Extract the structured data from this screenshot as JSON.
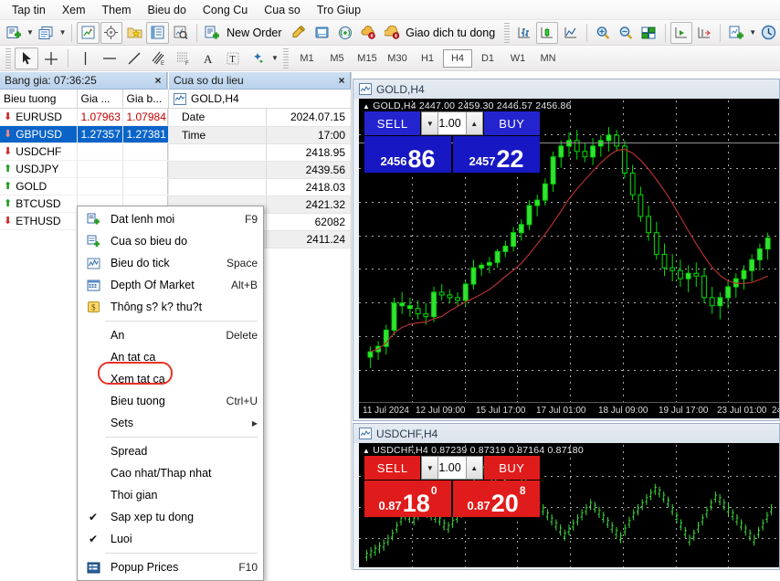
{
  "menubar": {
    "items": [
      {
        "label": "Tap tin"
      },
      {
        "label": "Xem"
      },
      {
        "label": "Them"
      },
      {
        "label": "Bieu do"
      },
      {
        "label": "Cong Cu"
      },
      {
        "label": "Cua so"
      },
      {
        "label": "Tro Giup"
      }
    ]
  },
  "toolbar_main": {
    "new_order_label": "New Order",
    "autotrading_label": "Giao dich tu dong",
    "icons": [
      "new-chart-icon",
      "chart-window-icon",
      "market-watch-icon",
      "navigator-icon",
      "favorites-icon",
      "data-window-icon",
      "terminal-icon",
      "new-order-icon",
      "metaeditor-icon",
      "mql5-community-icon",
      "signals-icon",
      "vps-icon",
      "bar-chart-icon",
      "candlestick-chart-icon",
      "line-chart-icon",
      "zoom-in-icon",
      "zoom-out-icon",
      "tile-windows-icon",
      "autoscroll-icon",
      "chart-shift-icon",
      "templates-icon",
      "period-icon"
    ]
  },
  "toolbar_tools": {
    "icons": [
      "cursor-icon",
      "crosshair-icon",
      "vertical-line-icon",
      "horizontal-line-icon",
      "trendline-icon",
      "equidistant-channel-icon",
      "fibonacci-icon",
      "text-icon",
      "text-label-icon",
      "objects-icon"
    ]
  },
  "timeframes": {
    "items": [
      "M1",
      "M5",
      "M15",
      "M30",
      "H1",
      "H4",
      "D1",
      "W1",
      "MN"
    ],
    "active": "H4"
  },
  "market_watch": {
    "title": "Bang gia: 07:36:25",
    "close_label": "×",
    "columns": [
      "Bieu tuong",
      "Gia ...",
      "Gia b..."
    ],
    "rows": [
      {
        "symbol": "EURUSD",
        "dir": "down",
        "bid": "1.07963",
        "ask": "1.07984",
        "selected": false
      },
      {
        "symbol": "GBPUSD",
        "dir": "down",
        "bid": "1.27357",
        "ask": "1.27381",
        "selected": true
      },
      {
        "symbol": "USDCHF",
        "dir": "down",
        "bid": "",
        "ask": "",
        "selected": false
      },
      {
        "symbol": "USDJPY",
        "dir": "up",
        "bid": "",
        "ask": "",
        "selected": false
      },
      {
        "symbol": "GOLD",
        "dir": "up",
        "bid": "",
        "ask": "",
        "selected": false
      },
      {
        "symbol": "BTCUSD",
        "dir": "up",
        "bid": "",
        "ask": "",
        "selected": false
      },
      {
        "symbol": "ETHUSD",
        "dir": "down",
        "bid": "",
        "ask": "",
        "selected": false
      }
    ]
  },
  "data_window": {
    "title": "Cua so du lieu",
    "close_label": "×",
    "symbol": "GOLD,H4",
    "rows": [
      {
        "label": "Date",
        "value": "2024.07.15"
      },
      {
        "label": "Time",
        "value": "17:00"
      },
      {
        "label": "",
        "value": "2418.95"
      },
      {
        "label": "",
        "value": "2439.56"
      },
      {
        "label": "",
        "value": "2418.03"
      },
      {
        "label": "",
        "value": "2421.32"
      },
      {
        "label": "",
        "value": "62082"
      },
      {
        "label": "",
        "value": "2411.24"
      }
    ]
  },
  "context_menu": {
    "items": [
      {
        "label": "Dat lenh moi",
        "key": "F9",
        "icon": "new-order-icon",
        "check": false,
        "submenu": false
      },
      {
        "label": "Cua so bieu do",
        "key": "",
        "icon": "chart-window-icon",
        "check": false,
        "submenu": false
      },
      {
        "label": "Bieu do tick",
        "key": "Space",
        "icon": "tick-chart-icon",
        "check": false,
        "submenu": false
      },
      {
        "label": "Depth Of Market",
        "key": "Alt+B",
        "icon": "depth-of-market-icon",
        "check": false,
        "submenu": false
      },
      {
        "label": "Thông s? k? thu?t",
        "key": "",
        "icon": "specification-icon",
        "check": false,
        "submenu": false
      },
      {
        "separator": true
      },
      {
        "label": "An",
        "key": "Delete",
        "icon": "",
        "check": false,
        "submenu": false
      },
      {
        "label": "An tat ca",
        "key": "",
        "icon": "",
        "check": false,
        "submenu": false
      },
      {
        "label": "Xem tat ca",
        "key": "",
        "icon": "",
        "check": false,
        "submenu": false,
        "highlighted": true
      },
      {
        "label": "Bieu tuong",
        "key": "Ctrl+U",
        "icon": "",
        "check": false,
        "submenu": false
      },
      {
        "label": "Sets",
        "key": "",
        "icon": "",
        "check": false,
        "submenu": true
      },
      {
        "separator": true
      },
      {
        "label": "Spread",
        "key": "",
        "icon": "",
        "check": false,
        "submenu": false
      },
      {
        "label": "Cao nhat/Thap nhat",
        "key": "",
        "icon": "",
        "check": false,
        "submenu": false
      },
      {
        "label": "Thoi gian",
        "key": "",
        "icon": "",
        "check": false,
        "submenu": false
      },
      {
        "label": "Sap xep tu dong",
        "key": "",
        "icon": "",
        "check": true,
        "submenu": false
      },
      {
        "label": "Luoi",
        "key": "",
        "icon": "",
        "check": true,
        "submenu": false
      },
      {
        "separator": true
      },
      {
        "label": "Popup Prices",
        "key": "F10",
        "icon": "popup-prices-icon",
        "check": false,
        "submenu": false
      }
    ]
  },
  "chart_gold": {
    "title": "GOLD,H4",
    "ohlc_line": "GOLD,H4  2447.00 2459.30 2446.57 2456.86",
    "trade": {
      "sell_label": "SELL",
      "buy_label": "BUY",
      "volume": "1.00",
      "sell_big": "86",
      "sell_small": "2456",
      "buy_big": "22",
      "buy_small": "2457",
      "theme": "blue"
    },
    "xaxis": [
      "11 Jul 2024",
      "12 Jul 09:00",
      "15 Jul 17:00",
      "17 Jul 01:00",
      "18 Jul 09:00",
      "19 Jul 17:00",
      "23 Jul 01:00",
      "24"
    ]
  },
  "chart_usdchf": {
    "title": "USDCHF,H4",
    "ohlc_line": "USDCHF,H4  0.87239 0.87319 0.87164 0.87180",
    "trade": {
      "sell_label": "SELL",
      "buy_label": "BUY",
      "volume": "1.00",
      "sell_big": "18",
      "sell_sup": "0",
      "sell_small": "0.87",
      "buy_big": "20",
      "buy_sup": "8",
      "buy_small": "0.87",
      "theme": "red"
    }
  },
  "chart_data": {
    "type": "candlestick",
    "title": "GOLD,H4",
    "ohlc": {
      "open": 2447.0,
      "high": 2459.3,
      "low": 2446.57,
      "close": 2456.86
    },
    "xlabels": [
      "11 Jul 2024",
      "12 Jul 09:00",
      "15 Jul 17:00",
      "17 Jul 01:00",
      "18 Jul 09:00",
      "19 Jul 17:00",
      "23 Jul 01:00",
      "24"
    ],
    "candles": [
      {
        "o": 12,
        "h": 16,
        "l": 8,
        "c": 14,
        "up": true
      },
      {
        "o": 14,
        "h": 18,
        "l": 11,
        "c": 16,
        "up": true
      },
      {
        "o": 16,
        "h": 24,
        "l": 13,
        "c": 22,
        "up": true
      },
      {
        "o": 22,
        "h": 34,
        "l": 20,
        "c": 32,
        "up": true
      },
      {
        "o": 32,
        "h": 36,
        "l": 28,
        "c": 31,
        "up": true
      },
      {
        "o": 31,
        "h": 34,
        "l": 27,
        "c": 30,
        "up": true
      },
      {
        "o": 30,
        "h": 33,
        "l": 26,
        "c": 28,
        "up": false
      },
      {
        "o": 28,
        "h": 32,
        "l": 24,
        "c": 27,
        "up": false
      },
      {
        "o": 27,
        "h": 38,
        "l": 25,
        "c": 36,
        "up": true
      },
      {
        "o": 36,
        "h": 39,
        "l": 33,
        "c": 35,
        "up": false
      },
      {
        "o": 35,
        "h": 37,
        "l": 32,
        "c": 34,
        "up": false
      },
      {
        "o": 34,
        "h": 36,
        "l": 31,
        "c": 33,
        "up": false
      },
      {
        "o": 33,
        "h": 40,
        "l": 31,
        "c": 39,
        "up": true
      },
      {
        "o": 39,
        "h": 48,
        "l": 37,
        "c": 45,
        "up": true
      },
      {
        "o": 45,
        "h": 47,
        "l": 42,
        "c": 46,
        "up": true
      },
      {
        "o": 46,
        "h": 49,
        "l": 43,
        "c": 47,
        "up": true
      },
      {
        "o": 47,
        "h": 52,
        "l": 45,
        "c": 51,
        "up": true
      },
      {
        "o": 51,
        "h": 55,
        "l": 49,
        "c": 53,
        "up": true
      },
      {
        "o": 53,
        "h": 60,
        "l": 51,
        "c": 58,
        "up": true
      },
      {
        "o": 58,
        "h": 63,
        "l": 55,
        "c": 61,
        "up": true
      },
      {
        "o": 61,
        "h": 70,
        "l": 59,
        "c": 68,
        "up": true
      },
      {
        "o": 68,
        "h": 72,
        "l": 64,
        "c": 70,
        "up": true
      },
      {
        "o": 70,
        "h": 78,
        "l": 68,
        "c": 76,
        "up": true
      },
      {
        "o": 76,
        "h": 88,
        "l": 73,
        "c": 86,
        "up": true
      },
      {
        "o": 86,
        "h": 92,
        "l": 82,
        "c": 90,
        "up": true
      },
      {
        "o": 90,
        "h": 95,
        "l": 86,
        "c": 92,
        "up": true
      },
      {
        "o": 92,
        "h": 96,
        "l": 85,
        "c": 88,
        "up": false
      },
      {
        "o": 88,
        "h": 91,
        "l": 84,
        "c": 86,
        "up": false
      },
      {
        "o": 86,
        "h": 93,
        "l": 83,
        "c": 90,
        "up": true
      },
      {
        "o": 90,
        "h": 94,
        "l": 86,
        "c": 92,
        "up": true
      },
      {
        "o": 92,
        "h": 97,
        "l": 88,
        "c": 94,
        "up": true
      },
      {
        "o": 94,
        "h": 96,
        "l": 88,
        "c": 90,
        "up": false
      },
      {
        "o": 90,
        "h": 92,
        "l": 78,
        "c": 80,
        "up": false
      },
      {
        "o": 80,
        "h": 83,
        "l": 70,
        "c": 72,
        "up": false
      },
      {
        "o": 72,
        "h": 75,
        "l": 62,
        "c": 64,
        "up": false
      },
      {
        "o": 64,
        "h": 68,
        "l": 55,
        "c": 58,
        "up": false
      },
      {
        "o": 58,
        "h": 62,
        "l": 48,
        "c": 50,
        "up": false
      },
      {
        "o": 50,
        "h": 54,
        "l": 42,
        "c": 45,
        "up": false
      },
      {
        "o": 45,
        "h": 50,
        "l": 40,
        "c": 44,
        "up": false
      },
      {
        "o": 44,
        "h": 48,
        "l": 38,
        "c": 41,
        "up": false
      },
      {
        "o": 41,
        "h": 46,
        "l": 36,
        "c": 43,
        "up": true
      },
      {
        "o": 43,
        "h": 47,
        "l": 38,
        "c": 42,
        "up": false
      },
      {
        "o": 42,
        "h": 45,
        "l": 32,
        "c": 34,
        "up": false
      },
      {
        "o": 34,
        "h": 38,
        "l": 28,
        "c": 31,
        "up": false
      },
      {
        "o": 31,
        "h": 36,
        "l": 26,
        "c": 34,
        "up": true
      },
      {
        "o": 34,
        "h": 40,
        "l": 30,
        "c": 38,
        "up": true
      },
      {
        "o": 38,
        "h": 43,
        "l": 34,
        "c": 41,
        "up": true
      },
      {
        "o": 41,
        "h": 46,
        "l": 37,
        "c": 44,
        "up": true
      },
      {
        "o": 44,
        "h": 50,
        "l": 40,
        "c": 48,
        "up": true
      },
      {
        "o": 48,
        "h": 54,
        "l": 44,
        "c": 52,
        "up": true
      },
      {
        "o": 52,
        "h": 58,
        "l": 48,
        "c": 56,
        "up": true
      }
    ],
    "ma_color": "#b03030",
    "candle_up_color": "#00e000",
    "candle_down_color": "#00a000"
  }
}
